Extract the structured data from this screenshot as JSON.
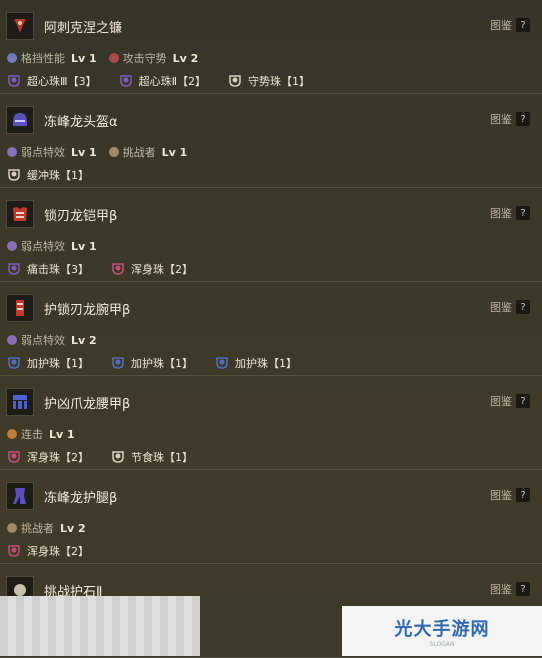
{
  "tujian_label": "图鉴",
  "help_glyph": "?",
  "items": [
    {
      "name": "阿刺克涅之镰",
      "icon": "scythe-weapon-icon",
      "icon_color": "#b23a35",
      "skills": [
        {
          "name": "格挡性能",
          "lv": "Lv 1",
          "color": "#6f7ab8"
        },
        {
          "name": "攻击守势",
          "lv": "Lv 2",
          "color": "#a84a4a"
        }
      ],
      "decos": [
        {
          "name": "超心珠Ⅲ【3】",
          "icon": "decoration-slot-3-icon",
          "color": "#7d5fb8"
        },
        {
          "name": "超心珠Ⅱ【2】",
          "icon": "decoration-slot-2-icon",
          "color": "#7d5fb8"
        },
        {
          "name": "守势珠【1】",
          "icon": "decoration-slot-1-icon",
          "color": "#d6d0bd"
        }
      ]
    },
    {
      "name": "冻峰龙头盔α",
      "icon": "helmet-icon",
      "icon_color": "#5b4fb9",
      "skills": [
        {
          "name": "弱点特效",
          "lv": "Lv 1",
          "color": "#8a6fb8"
        },
        {
          "name": "挑战者",
          "lv": "Lv 1",
          "color": "#a08a6a"
        }
      ],
      "decos": [
        {
          "name": "缓冲珠【1】",
          "icon": "decoration-slot-1-icon",
          "color": "#d6d0bd"
        }
      ]
    },
    {
      "name": "锁刃龙铠甲β",
      "icon": "chest-armor-icon",
      "icon_color": "#c0392b",
      "skills": [
        {
          "name": "弱点特效",
          "lv": "Lv 1",
          "color": "#8a6fb8"
        }
      ],
      "decos": [
        {
          "name": "痛击珠【3】",
          "icon": "decoration-slot-3-icon",
          "color": "#7d5fb8"
        },
        {
          "name": "浑身珠【2】",
          "icon": "decoration-slot-2-icon",
          "color": "#c0507a"
        }
      ]
    },
    {
      "name": "护锁刃龙腕甲β",
      "icon": "arm-armor-icon",
      "icon_color": "#c0392b",
      "skills": [
        {
          "name": "弱点特效",
          "lv": "Lv 2",
          "color": "#8a6fb8"
        }
      ],
      "decos": [
        {
          "name": "加护珠【1】",
          "icon": "decoration-slot-1-icon",
          "color": "#4f6fc0"
        },
        {
          "name": "加护珠【1】",
          "icon": "decoration-slot-1-icon",
          "color": "#4f6fc0"
        },
        {
          "name": "加护珠【1】",
          "icon": "decoration-slot-1-icon",
          "color": "#4f6fc0"
        }
      ]
    },
    {
      "name": "护凶爪龙腰甲β",
      "icon": "waist-armor-icon",
      "icon_color": "#4e5fd0",
      "skills": [
        {
          "name": "连击",
          "lv": "Lv 1",
          "color": "#c07a3a"
        }
      ],
      "decos": [
        {
          "name": "浑身珠【2】",
          "icon": "decoration-slot-2-icon",
          "color": "#c0507a"
        },
        {
          "name": "节食珠【1】",
          "icon": "decoration-slot-1-icon",
          "color": "#d6d0bd"
        }
      ]
    },
    {
      "name": "冻峰龙护腿β",
      "icon": "leg-armor-icon",
      "icon_color": "#5b4fb9",
      "skills": [
        {
          "name": "挑战者",
          "lv": "Lv 2",
          "color": "#a08a6a"
        }
      ],
      "decos": [
        {
          "name": "浑身珠【2】",
          "icon": "decoration-slot-2-icon",
          "color": "#c0507a"
        }
      ]
    },
    {
      "name": "挑战护石Ⅱ",
      "icon": "charm-icon",
      "icon_color": "#c8c0a8",
      "skills": [],
      "decos": []
    }
  ],
  "watermark": {
    "text": "光大手游网",
    "sub": "SLOGAN"
  }
}
